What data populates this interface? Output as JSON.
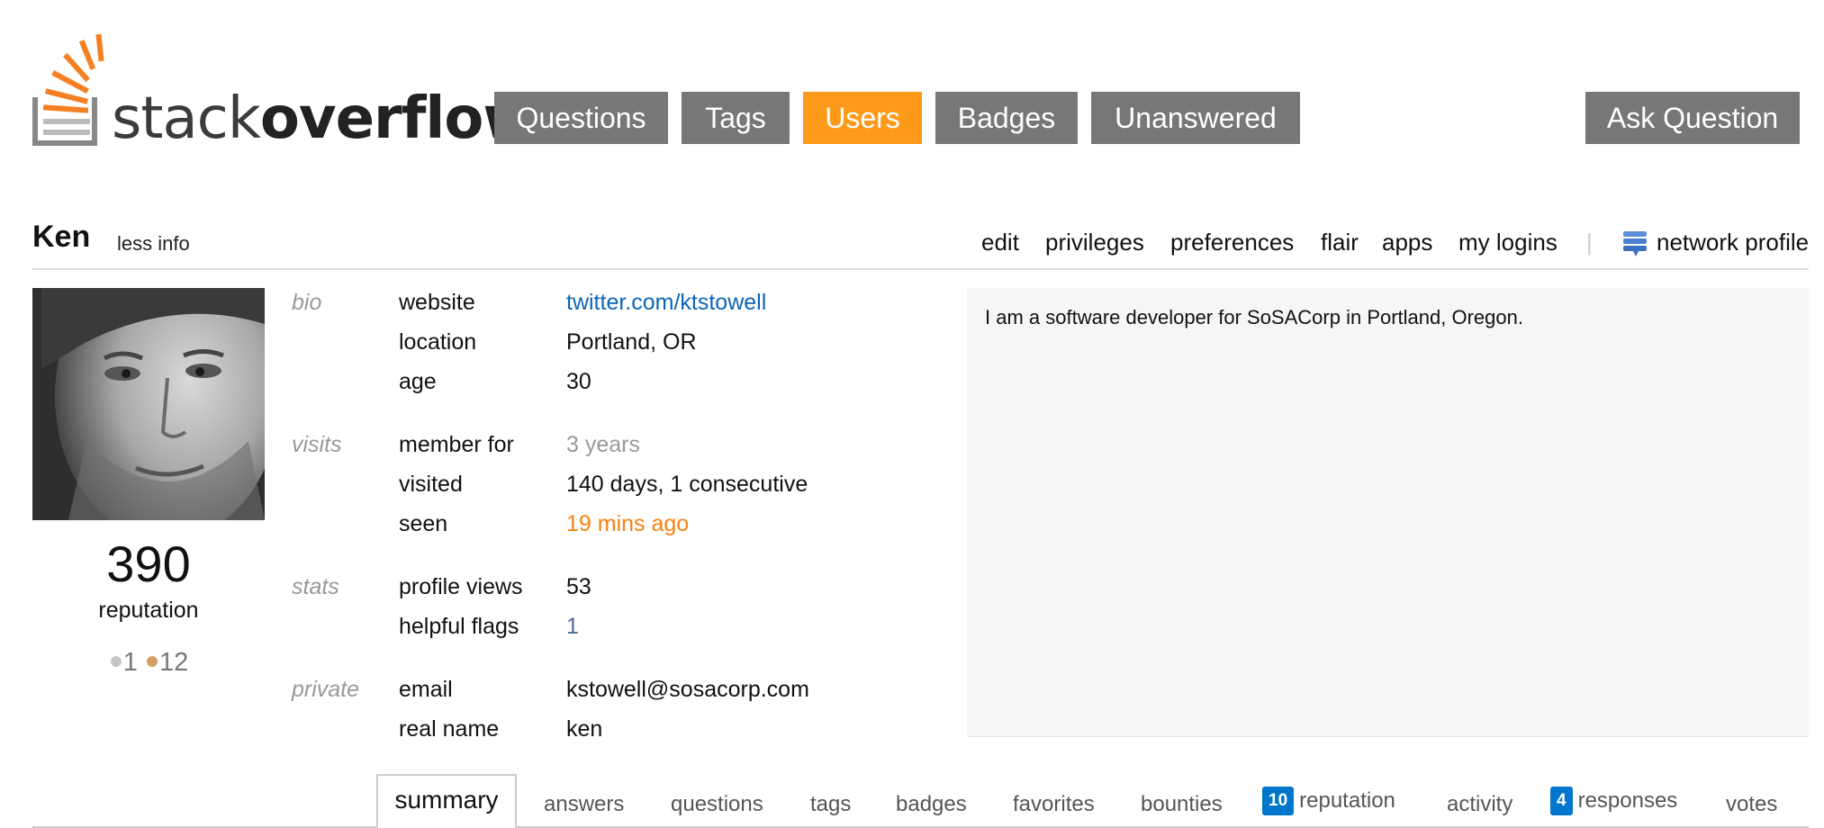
{
  "header": {
    "logo_light": "stack",
    "logo_bold": "overflow",
    "nav": [
      {
        "label": "Questions",
        "active": false
      },
      {
        "label": "Tags",
        "active": false
      },
      {
        "label": "Users",
        "active": true
      },
      {
        "label": "Badges",
        "active": false
      },
      {
        "label": "Unanswered",
        "active": false
      }
    ],
    "ask_button": "Ask Question"
  },
  "user": {
    "name": "Ken",
    "less_info": "less info",
    "links": [
      "edit",
      "privileges",
      "preferences",
      "flair",
      "apps",
      "my logins"
    ],
    "separator": "|",
    "network_profile": "network profile",
    "reputation": "390",
    "reputation_label": "reputation",
    "badges": {
      "silver": "1",
      "bronze": "12"
    }
  },
  "info": {
    "bio_label": "bio",
    "website_label": "website",
    "website_value": "twitter.com/ktstowell",
    "location_label": "location",
    "location_value": "Portland, OR",
    "age_label": "age",
    "age_value": "30",
    "visits_label": "visits",
    "member_label": "member for",
    "member_value": "3 years",
    "visited_label": "visited",
    "visited_value": "140 days, 1 consecutive",
    "seen_label": "seen",
    "seen_value": "19 mins ago",
    "stats_label": "stats",
    "views_label": "profile views",
    "views_value": "53",
    "flags_label": "helpful flags",
    "flags_value": "1",
    "private_label": "private",
    "email_label": "email",
    "email_value": "kstowell@sosacorp.com",
    "realname_label": "real name",
    "realname_value": "ken"
  },
  "about": "I am a software developer for SoSACorp in Portland, Oregon.",
  "tabs": {
    "summary": "summary",
    "answers": "answers",
    "questions": "questions",
    "tags": "tags",
    "badges": "badges",
    "favorites": "favorites",
    "bounties": "bounties",
    "reputation_count": "10",
    "reputation": "reputation",
    "activity": "activity",
    "responses_count": "4",
    "responses": "responses",
    "votes": "votes"
  },
  "colors": {
    "nav_gray": "#777777",
    "nav_active": "#fe9a1a",
    "link_blue": "#0b65b7",
    "seen_orange": "#f68210",
    "badge_blue": "#0077cc"
  }
}
